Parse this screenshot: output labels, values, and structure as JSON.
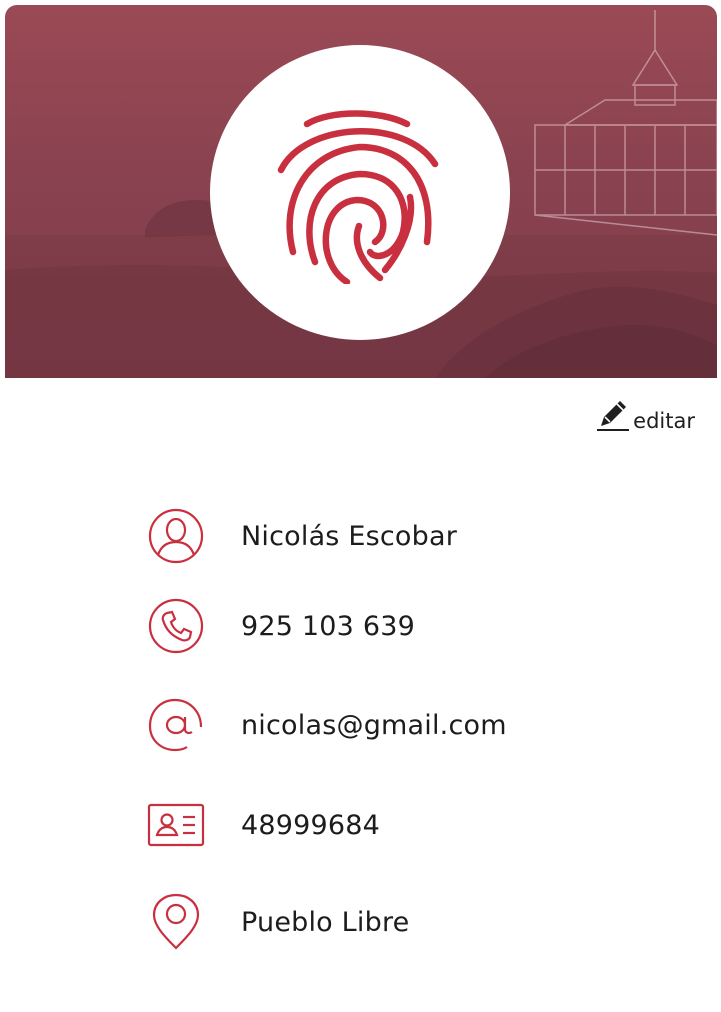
{
  "profile": {
    "edit_label": "editar",
    "fields": [
      {
        "icon": "user-circle-icon",
        "value": "Nicolás Escobar"
      },
      {
        "icon": "phone-icon",
        "value": "925 103 639"
      },
      {
        "icon": "at-sign-icon",
        "value": "nicolas@gmail.com"
      },
      {
        "icon": "id-card-icon",
        "value": "48999684"
      },
      {
        "icon": "location-pin-icon",
        "value": "Pueblo Libre"
      }
    ]
  },
  "colors": {
    "accent": "#c9303f",
    "header_overlay": "#8f4652",
    "text": "#1c1c1c"
  }
}
